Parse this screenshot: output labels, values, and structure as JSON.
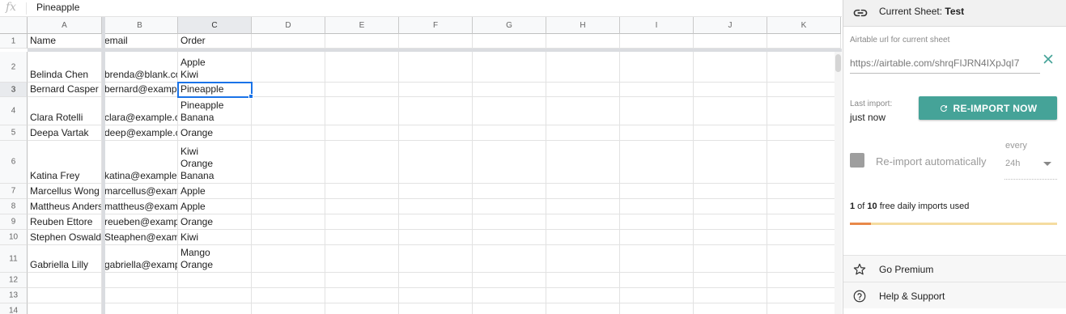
{
  "formula_bar": {
    "icon_text": "fx",
    "value": "Pineapple"
  },
  "columns": [
    "A",
    "B",
    "C",
    "D",
    "E",
    "F",
    "G",
    "H",
    "I",
    "J",
    "K"
  ],
  "row_numbers": [
    "1",
    "2",
    "3",
    "4",
    "5",
    "6",
    "7",
    "8",
    "9",
    "10",
    "11",
    "12",
    "13",
    "14"
  ],
  "rows": [
    [
      "Name",
      "email",
      "Order"
    ],
    [
      "Belinda Chen",
      "brenda@blank.com",
      "Apple\nKiwi"
    ],
    [
      "Bernard Casper",
      "bernard@example.com",
      "Pineapple"
    ],
    [
      "Clara Rotelli",
      "clara@example.com",
      "Pineapple\nBanana"
    ],
    [
      "Deepa Vartak",
      "deep@example.com",
      "Orange"
    ],
    [
      "Katina Frey",
      "katina@example.com",
      "Kiwi\nOrange\nBanana"
    ],
    [
      "Marcellus Wong",
      "marcellus@example.com",
      "Apple"
    ],
    [
      "Mattheus Anderson",
      "mattheus@example.com",
      "Apple"
    ],
    [
      "Reuben Ettore",
      "reueben@example.com",
      "Orange"
    ],
    [
      "Stephen Oswald",
      "Steaphen@example.com",
      "Kiwi"
    ],
    [
      "Gabriella Lilly",
      "gabriella@example.com",
      "Mango\nOrange"
    ],
    [
      "",
      "",
      ""
    ],
    [
      "",
      "",
      ""
    ],
    [
      "",
      "",
      ""
    ]
  ],
  "selected_cell": "C3",
  "sidebar": {
    "title_prefix": "Current Sheet: ",
    "sheet_name": "Test",
    "url_label": "Airtable url for current sheet",
    "url_value": "https://airtable.com/shrqFIJRN4IXpJqI7",
    "last_import_label": "Last import:",
    "last_import_value": "just now",
    "reimport_button": "RE-IMPORT NOW",
    "auto_import_label": "Re-import automatically",
    "auto_import_checked": false,
    "every_label": "every",
    "interval_value": "24h",
    "usage": {
      "used": "1",
      "of_word": " of ",
      "limit": "10",
      "suffix": " free daily imports used",
      "fraction": 0.1
    },
    "menu": [
      {
        "label": "Go Premium",
        "icon": "star-icon"
      },
      {
        "label": "Help & Support",
        "icon": "help-circle-icon"
      }
    ],
    "colors": {
      "accent": "#45a398",
      "usage_fill": "#e8894a",
      "usage_track": "#f5dca0",
      "selection": "#1a73e8"
    }
  }
}
